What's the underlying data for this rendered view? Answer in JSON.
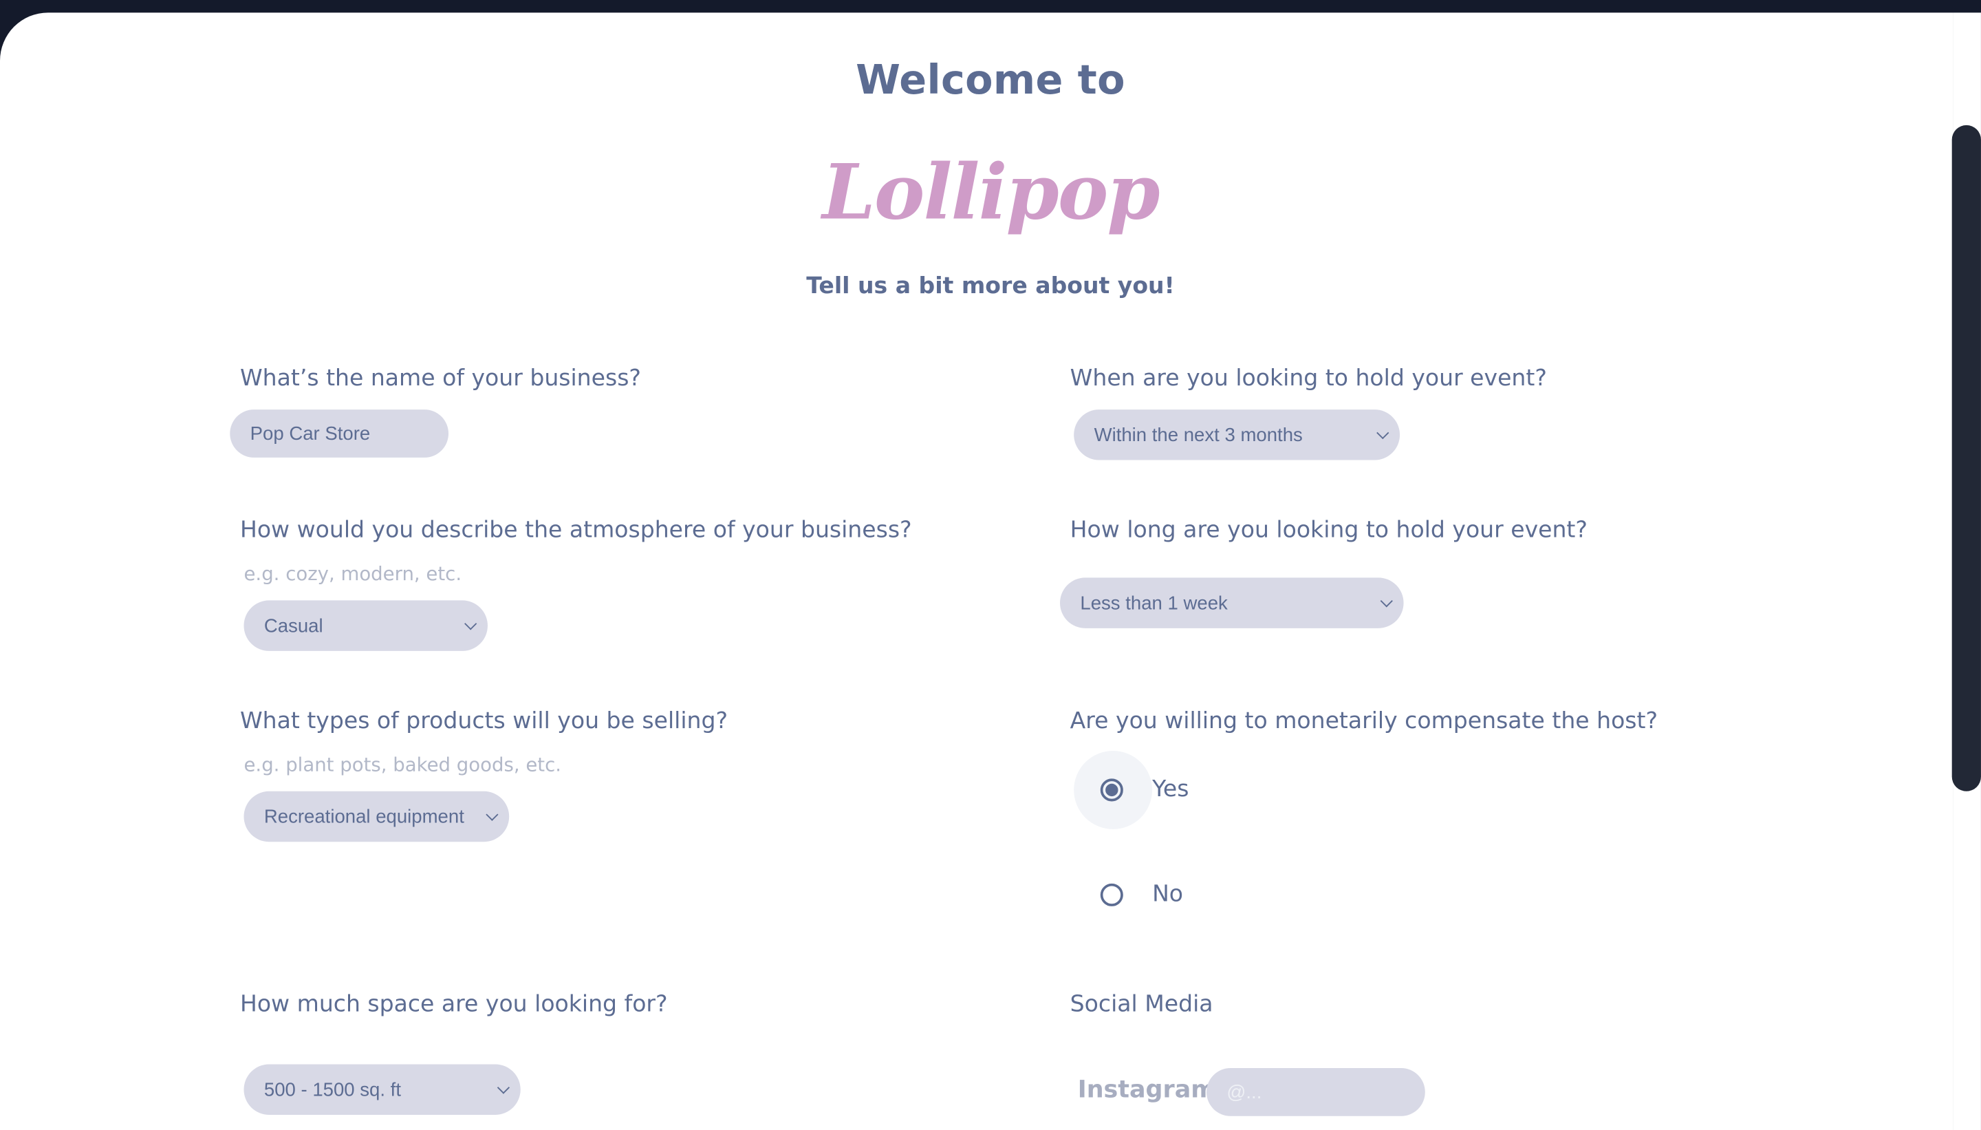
{
  "header": {
    "welcome": "Welcome to",
    "logo": "Lollipop",
    "tagline": "Tell us a bit more about you!"
  },
  "left": {
    "business_name": {
      "question": "What’s the name of your business?",
      "value": "Pop Car Store"
    },
    "atmosphere": {
      "question": "How would you describe the atmosphere of your business?",
      "hint": "e.g. cozy, modern, etc.",
      "selected": "Casual"
    },
    "products": {
      "question": "What types of products will you be selling?",
      "hint": "e.g. plant pots, baked goods, etc.",
      "selected": "Recreational equipment"
    },
    "space": {
      "question": "How much space are you looking for?",
      "selected": "500 - 1500 sq. ft"
    }
  },
  "right": {
    "when": {
      "question": "When are you looking to hold your event?",
      "selected": "Within the next 3 months"
    },
    "duration": {
      "question": "How long are you looking to hold your event?",
      "selected": "Less than 1 week"
    },
    "compensate": {
      "question": "Are you willing to monetarily compensate the host?",
      "options": [
        {
          "label": "Yes",
          "selected": true
        },
        {
          "label": "No",
          "selected": false
        }
      ]
    },
    "social": {
      "question": "Social Media",
      "instagram_label": "Instagram",
      "instagram_placeholder": "@..."
    }
  },
  "colors": {
    "accent": "#5c6c92",
    "logo": "#cf9cc8",
    "field_bg": "#d8d9e6",
    "frame": "#141a2b"
  }
}
